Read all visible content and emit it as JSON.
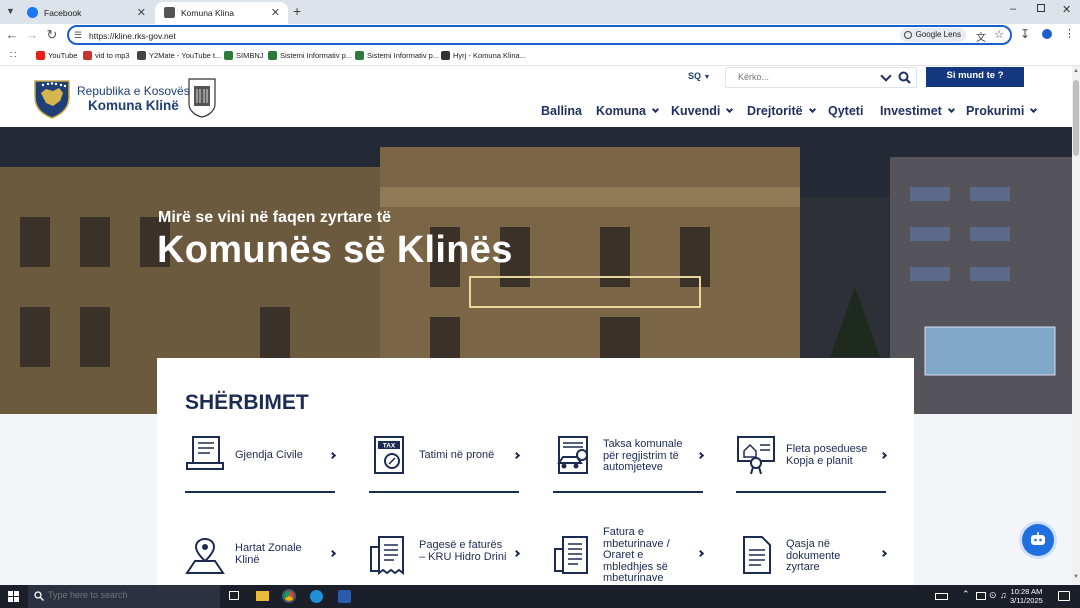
{
  "browser": {
    "tabs": [
      {
        "label": "Facebook",
        "active": false
      },
      {
        "label": "Komuna Klina",
        "active": true
      }
    ],
    "url": "https://kline.rks-gov.net",
    "lens_label": "Google Lens",
    "bookmarks": [
      {
        "label": "YouTube"
      },
      {
        "label": "vid to mp3"
      },
      {
        "label": "Y2Mate - YouTube t..."
      },
      {
        "label": "SIMBNJ"
      },
      {
        "label": "Sistemi Informativ p..."
      },
      {
        "label": "Sistemi Informativ p..."
      },
      {
        "label": "Hyrj - Komuna Klina..."
      }
    ]
  },
  "site": {
    "brand_line1": "Republika e Kosovës",
    "brand_line2": "Komuna Klinë",
    "language": "SQ",
    "search_placeholder": "Kërko...",
    "cta_label": "Si mund te ?",
    "nav": [
      {
        "label": "Ballina",
        "dropdown": false
      },
      {
        "label": "Komuna",
        "dropdown": true
      },
      {
        "label": "Kuvendi",
        "dropdown": true
      },
      {
        "label": "Drejtoritë",
        "dropdown": true
      },
      {
        "label": "Qyteti",
        "dropdown": false
      },
      {
        "label": "Investimet",
        "dropdown": true
      },
      {
        "label": "Prokurimi",
        "dropdown": true
      }
    ],
    "hero_welcome": "Mirë se vini në faqen zyrtare të",
    "hero_title": "Komunës së Klinës",
    "services_title": "SHËRBIMET",
    "services": [
      {
        "label": "Gjendja Civile",
        "icon": "computer-user-icon"
      },
      {
        "label": "Tatimi në pronë",
        "icon": "tax-document-icon"
      },
      {
        "label": "Taksa komunale për regjistrim të automjeteve",
        "icon": "car-document-icon"
      },
      {
        "label": "Fleta poseduese Kopja e planit",
        "icon": "property-certificate-icon"
      },
      {
        "label": "Hartat Zonale Klinë",
        "icon": "map-pin-icon"
      },
      {
        "label": "Pagesë e faturës – KRU Hidro Drini",
        "icon": "receipt-icon"
      },
      {
        "label": "Fatura e mbeturinave / Oraret e mbledhjes së mbeturinave",
        "icon": "invoice-icon"
      },
      {
        "label": "Qasja në dokumente zyrtare",
        "icon": "document-icon"
      }
    ]
  },
  "taskbar": {
    "search_placeholder": "Type here to search",
    "time": "10:28 AM",
    "date": "3/11/2025"
  },
  "colors": {
    "brand": "#14387f",
    "nav_text": "#1f3160",
    "omnibox_border": "#1a5fcf",
    "chat": "#1f6fe0"
  }
}
